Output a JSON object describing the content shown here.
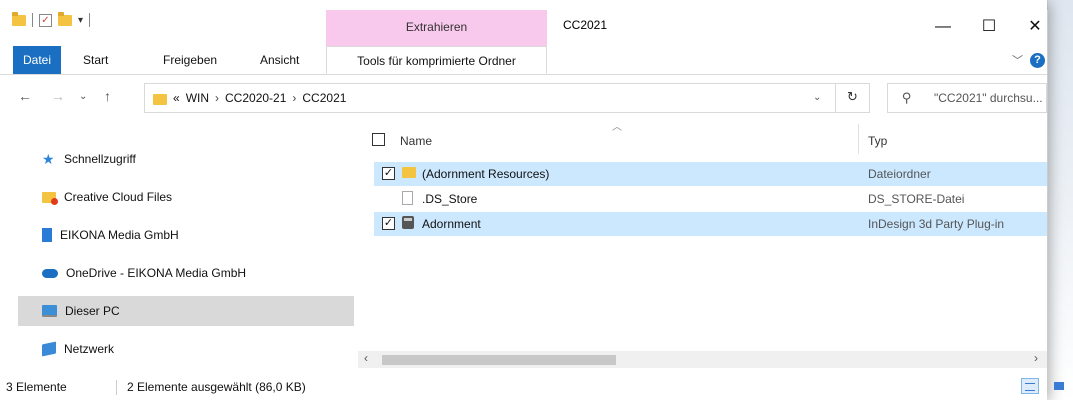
{
  "window": {
    "title": "CC2021",
    "context_group": "Extrahieren",
    "controls": {
      "minimize": "—",
      "maximize": "☐",
      "close": "✕"
    }
  },
  "ribbon": {
    "tabs": [
      {
        "label": "Datei",
        "active": true
      },
      {
        "label": "Start"
      },
      {
        "label": "Freigeben"
      },
      {
        "label": "Ansicht"
      },
      {
        "label": "Tools für komprimierte Ordner"
      }
    ],
    "collapse_icon": "chevron-down-icon",
    "help_label": "?"
  },
  "address": {
    "overflow": "«",
    "crumbs": [
      "WIN",
      "CC2020-21",
      "CC2021"
    ],
    "separator": "›"
  },
  "search": {
    "placeholder": "\"CC2021\" durchsu..."
  },
  "nav": {
    "items": [
      {
        "label": "Schnellzugriff",
        "icon": "star-icon"
      },
      {
        "label": "Creative Cloud Files",
        "icon": "creative-cloud-folder-icon"
      },
      {
        "label": "EIKONA Media GmbH",
        "icon": "building-icon"
      },
      {
        "label": "OneDrive - EIKONA Media GmbH",
        "icon": "cloud-icon"
      },
      {
        "label": "Dieser PC",
        "icon": "computer-icon",
        "selected": true
      },
      {
        "label": "Netzwerk",
        "icon": "network-icon"
      }
    ]
  },
  "files": {
    "columns": {
      "name": "Name",
      "type": "Typ"
    },
    "rows": [
      {
        "name": "(Adornment Resources)",
        "type": "Dateiordner",
        "icon": "folder-icon",
        "selected": true
      },
      {
        "name": ".DS_Store",
        "type": "DS_STORE-Datei",
        "icon": "file-icon",
        "selected": false
      },
      {
        "name": "Adornment",
        "type": "InDesign 3d Party Plug-in",
        "icon": "plugin-icon",
        "selected": true
      }
    ]
  },
  "status": {
    "count": "3 Elemente",
    "selection": "2 Elemente ausgewählt (86,0 KB)"
  },
  "colors": {
    "accent": "#1a6fc2",
    "context_tab": "#f8c9ec",
    "selection": "#cce8ff",
    "nav_selected": "#d9d9d9"
  }
}
